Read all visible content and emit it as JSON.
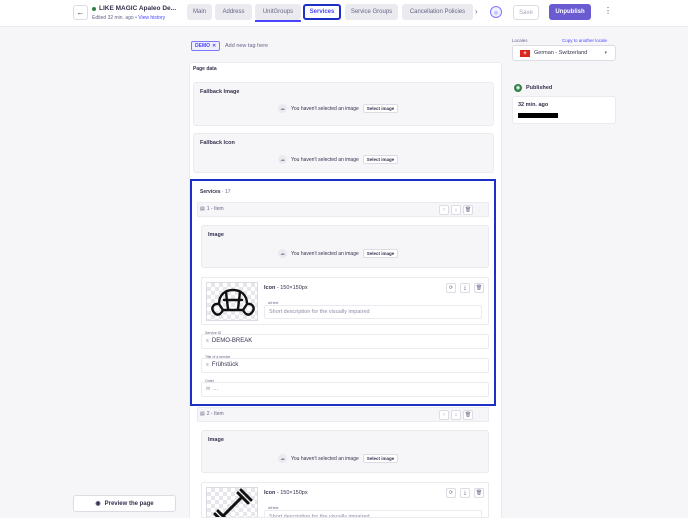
{
  "header": {
    "back_icon": "arrow-left-icon",
    "title": "LIKE MAGIC Apaleo De...",
    "edited": "Edited 32 min. ago",
    "separator": "•",
    "view_history": "View history",
    "tabs": [
      {
        "label": "Main",
        "active": false
      },
      {
        "label": "Address",
        "active": false
      },
      {
        "label": "UnitGroups",
        "active": false
      },
      {
        "label": "Services",
        "active": true
      },
      {
        "label": "Service Groups",
        "active": false
      },
      {
        "label": "Cancellation Policies",
        "active": false
      }
    ],
    "more_icon": "chevron-right-icon",
    "save_label": "Save",
    "unpublish_label": "Unpublish",
    "menu_icon": "more-vertical-icon",
    "accent_color": "#4945ff",
    "highlight_color": "#1c2fc7"
  },
  "tags": {
    "chip": "DEMO",
    "remove_icon": "close-icon",
    "add_placeholder": "Add new tag here"
  },
  "page_data": {
    "title": "Page data",
    "fallback_image": {
      "label": "Fallback Image",
      "empty_text": "You haven't selected an image",
      "button": "Select image"
    },
    "fallback_icon": {
      "label": "Fallback Icon",
      "empty_text": "You haven't selected an image",
      "button": "Select image"
    },
    "services": {
      "label": "Services",
      "count_sep": "·",
      "count": "17",
      "items": [
        {
          "label": "1 - Item",
          "image": {
            "label": "Image",
            "empty_text": "You haven't selected an image",
            "button": "Select image"
          },
          "icon": {
            "label": "Icon",
            "size": "150×150px",
            "alt_label": "alt text",
            "alt_placeholder": "Short description for the visually impaired",
            "pictogram": "croissant-icon"
          },
          "service_id": {
            "label": "Service ID",
            "value": "DEMO-BREAK"
          },
          "title": {
            "label": "Title of a service",
            "value": "Frühstück"
          },
          "order": {
            "label": "Order",
            "value": "..."
          }
        },
        {
          "label": "2 - Item",
          "image": {
            "label": "Image",
            "empty_text": "You haven't selected an image",
            "button": "Select image"
          },
          "icon": {
            "label": "Icon",
            "size": "150×150px",
            "alt_label": "alt text",
            "alt_placeholder": "Short description for the visually impaired",
            "pictogram": "dumbbell-icon"
          }
        }
      ]
    }
  },
  "sidebar": {
    "locales_label": "Locales",
    "copy_locale": "Copy to another locale",
    "locale_value": "German - Switzerland",
    "published_label": "Published",
    "published_time": "32 min. ago"
  },
  "preview": {
    "label": "Preview the page",
    "icon": "eye-icon"
  }
}
